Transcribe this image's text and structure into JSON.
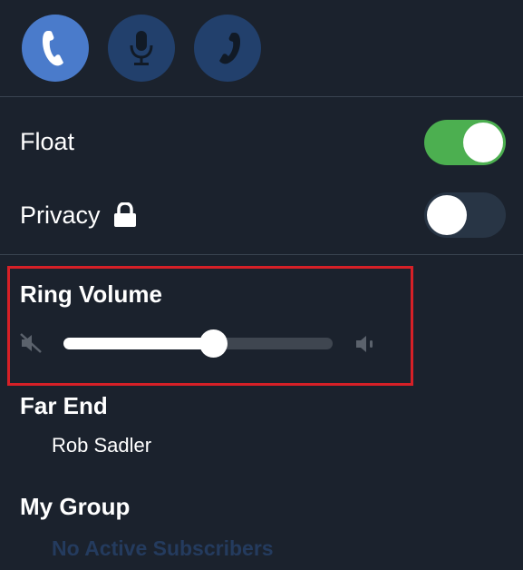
{
  "call_buttons": [
    {
      "name": "handset",
      "icon": "handset-icon",
      "active": true
    },
    {
      "name": "microphone",
      "icon": "microphone-icon",
      "active": false
    },
    {
      "name": "phone",
      "icon": "phone-icon",
      "active": false
    }
  ],
  "settings": {
    "float_label": "Float",
    "float_on": true,
    "privacy_label": "Privacy",
    "privacy_icon": "lock-icon",
    "privacy_on": false
  },
  "ring_volume": {
    "title": "Ring Volume",
    "level": 0.56,
    "min_icon": "speaker-mute-icon",
    "max_icon": "speaker-icon"
  },
  "far_end": {
    "title": "Far End",
    "name": "Rob Sadler"
  },
  "my_group": {
    "title": "My Group",
    "status": "No Active Subscribers"
  },
  "colors": {
    "background": "#1b222d",
    "active_button": "#4a7bcb",
    "inactive_button": "#22406c",
    "toggle_on": "#4caf50",
    "toggle_off": "#283545",
    "highlight": "#d62027",
    "muted_text": "#243b5e"
  }
}
